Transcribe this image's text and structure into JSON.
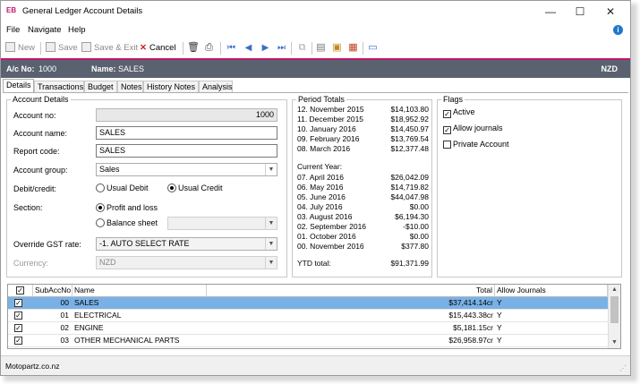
{
  "window": {
    "logo": "EB",
    "title": "General Ledger Account Details",
    "minimize": "—",
    "maximize": "☐",
    "close": "✕"
  },
  "menu": {
    "file": "File",
    "navigate": "Navigate",
    "help": "Help",
    "help_icon": "i"
  },
  "toolbar": {
    "new": "New",
    "save": "Save",
    "save_exit": "Save & Exit",
    "cancel": "Cancel"
  },
  "header": {
    "ac_label": "A/c No:",
    "ac_value": "1000",
    "name_label": "Name:",
    "name_value": "SALES",
    "currency": "NZD",
    "accent": "#c0186e"
  },
  "tabs": [
    "Details",
    "Transactions",
    "Budget",
    "Notes",
    "History Notes",
    "Analysis"
  ],
  "account_details": {
    "legend": "Account Details",
    "account_no_label": "Account no:",
    "account_no": "1000",
    "account_name_label": "Account name:",
    "account_name": "SALES",
    "report_code_label": "Report code:",
    "report_code": "SALES",
    "account_group_label": "Account group:",
    "account_group": "Sales",
    "debit_credit_label": "Debit/credit:",
    "usual_debit": "Usual Debit",
    "usual_credit": "Usual Credit",
    "section_label": "Section:",
    "profit_loss": "Profit and loss",
    "balance_sheet": "Balance sheet",
    "gst_label": "Override GST rate:",
    "gst_value": "-1. AUTO SELECT RATE",
    "currency_label": "Currency:",
    "currency_value": "NZD"
  },
  "period_totals": {
    "legend": "Period Totals",
    "prior": [
      {
        "period": "12. November 2015",
        "value": "$14,103.80"
      },
      {
        "period": "11. December 2015",
        "value": "$18,952.92"
      },
      {
        "period": "10. January 2016",
        "value": "$14,450.97"
      },
      {
        "period": "09. February 2016",
        "value": "$13,769.54"
      },
      {
        "period": "08. March 2016",
        "value": "$12,377.48"
      }
    ],
    "current_year_label": "Current Year:",
    "current": [
      {
        "period": "07. April 2016",
        "value": "$26,042.09"
      },
      {
        "period": "06. May 2016",
        "value": "$14,719.82"
      },
      {
        "period": "05. June 2016",
        "value": "$44,047.98"
      },
      {
        "period": "04. July 2016",
        "value": "$0.00"
      },
      {
        "period": "03. August 2016",
        "value": "$6,194.30"
      },
      {
        "period": "02. September 2016",
        "value": "-$10.00"
      },
      {
        "period": "01. October 2016",
        "value": "$0.00"
      },
      {
        "period": "00. November 2016",
        "value": "$377.80"
      }
    ],
    "ytd_label": "YTD total:",
    "ytd_value": "$91,371.99"
  },
  "flags": {
    "legend": "Flags",
    "active": "Active",
    "allow_journals": "Allow journals",
    "private_account": "Private Account"
  },
  "grid": {
    "columns": [
      "SubAccNo",
      "Name",
      "Total",
      "Allow Journals"
    ],
    "rows": [
      {
        "sub": "00",
        "name": "SALES",
        "total": "$37,414.14cr",
        "allow": "Y"
      },
      {
        "sub": "01",
        "name": "ELECTRICAL",
        "total": "$15,443.38cr",
        "allow": "Y"
      },
      {
        "sub": "02",
        "name": "ENGINE",
        "total": "$5,181.15cr",
        "allow": "Y"
      },
      {
        "sub": "03",
        "name": "OTHER MECHANICAL PARTS",
        "total": "$26,958.97cr",
        "allow": "Y"
      }
    ]
  },
  "status": {
    "text": "Motopartz.co.nz"
  }
}
